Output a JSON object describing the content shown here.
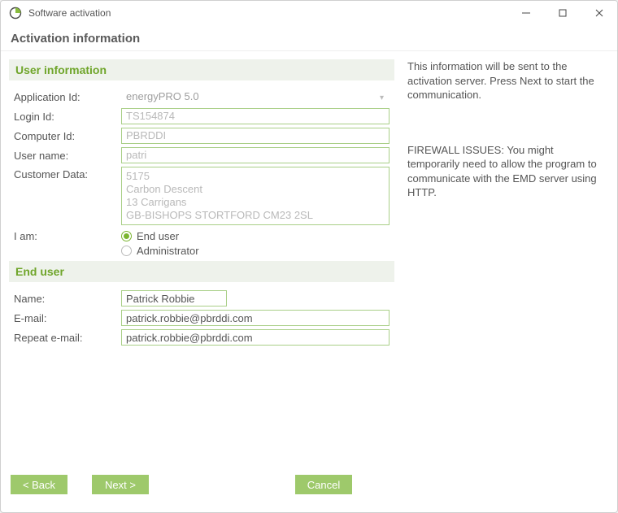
{
  "window": {
    "title": "Software activation"
  },
  "header": {
    "title": "Activation information"
  },
  "userInfo": {
    "sectionTitle": "User information",
    "labels": {
      "appId": "Application Id:",
      "loginId": "Login Id:",
      "computerId": "Computer Id:",
      "userName": "User name:",
      "customerData": "Customer Data:",
      "iAm": "I am:"
    },
    "appId": "energyPRO 5.0",
    "loginId": "TS154874",
    "computerId": "PBRDDI",
    "userName": "patri",
    "customerDataLines": [
      "5175",
      "Carbon Descent",
      "13 Carrigans",
      "GB-BISHOPS STORTFORD CM23 2SL"
    ],
    "roleOptions": {
      "endUser": "End user",
      "admin": "Administrator"
    },
    "selectedRole": "endUser"
  },
  "endUser": {
    "sectionTitle": "End user",
    "labels": {
      "name": "Name:",
      "email": "E-mail:",
      "repeatEmail": "Repeat e-mail:"
    },
    "name": "Patrick Robbie",
    "email": "patrick.robbie@pbrddi.com",
    "repeatEmail": "patrick.robbie@pbrddi.com"
  },
  "sidebar": {
    "intro": "This information will be sent to the activation server. Press Next to start the communication.",
    "firewall": "FIREWALL ISSUES: You might temporarily need to allow the program to communicate with the EMD server using HTTP."
  },
  "buttons": {
    "back": "< Back",
    "next": "Next >",
    "cancel": "Cancel"
  }
}
